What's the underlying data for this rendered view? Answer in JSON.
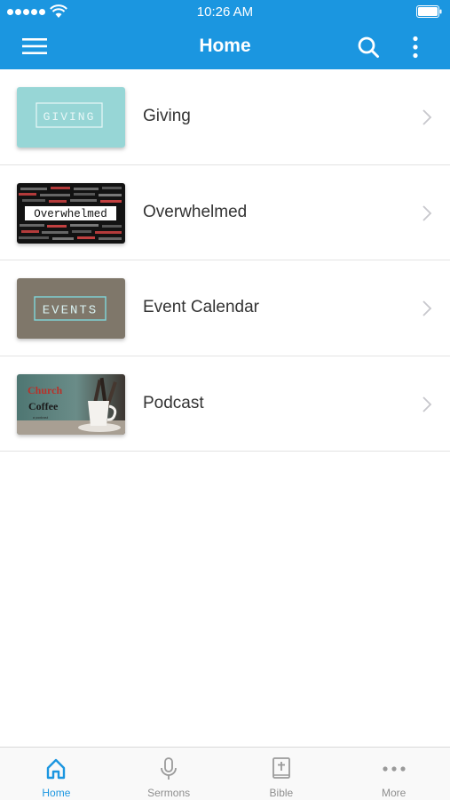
{
  "status_bar": {
    "time": "10:26 AM"
  },
  "nav": {
    "title": "Home"
  },
  "items": [
    {
      "label": "Giving",
      "thumb_text": "GIVING"
    },
    {
      "label": "Overwhelmed",
      "thumb_text": "Overwhelmed"
    },
    {
      "label": "Event Calendar",
      "thumb_text": "EVENTS"
    },
    {
      "label": "Podcast",
      "thumb_title_1": "Church",
      "thumb_title_2": "Coffee",
      "thumb_subtitle": "a podcast"
    }
  ],
  "tabs": [
    {
      "label": "Home",
      "icon": "home-icon",
      "active": true
    },
    {
      "label": "Sermons",
      "icon": "microphone-icon"
    },
    {
      "label": "Bible",
      "icon": "bible-icon"
    },
    {
      "label": "More",
      "icon": "more-dots-icon"
    }
  ],
  "colors": {
    "accent": "#1b96e0",
    "giving_bg": "#97d6d6",
    "events_bg": "#7f776a"
  }
}
